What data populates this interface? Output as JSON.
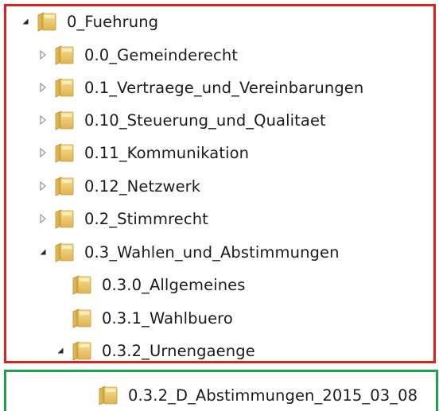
{
  "tree": {
    "items": [
      {
        "label": "0_Fuehrung",
        "state": "expanded",
        "level": 0
      },
      {
        "label": "0.0_Gemeinderecht",
        "state": "collapsed",
        "level": 1
      },
      {
        "label": "0.1_Vertraege_und_Vereinbarungen",
        "state": "collapsed",
        "level": 1
      },
      {
        "label": "0.10_Steuerung_und_Qualitaet",
        "state": "collapsed",
        "level": 1
      },
      {
        "label": "0.11_Kommunikation",
        "state": "collapsed",
        "level": 1
      },
      {
        "label": "0.12_Netzwerk",
        "state": "collapsed",
        "level": 1
      },
      {
        "label": "0.2_Stimmrecht",
        "state": "collapsed",
        "level": 1
      },
      {
        "label": "0.3_Wahlen_und_Abstimmungen",
        "state": "expanded",
        "level": 1
      },
      {
        "label": "0.3.0_Allgemeines",
        "state": "leaf",
        "level": 2
      },
      {
        "label": "0.3.1_Wahlbuero",
        "state": "leaf",
        "level": 2
      },
      {
        "label": "0.3.2_Urnengaenge",
        "state": "expanded",
        "level": 2
      },
      {
        "label": "0.3.2_D_Abstimmungen_2015_03_08",
        "state": "leaf",
        "level": 3
      }
    ]
  },
  "icons": {
    "folder": "folder-icon",
    "expanded": "expanded-arrow-icon",
    "collapsed": "collapsed-arrow-icon"
  },
  "colors": {
    "highlight_red": "#e0201c",
    "highlight_green": "#1ea24a"
  }
}
